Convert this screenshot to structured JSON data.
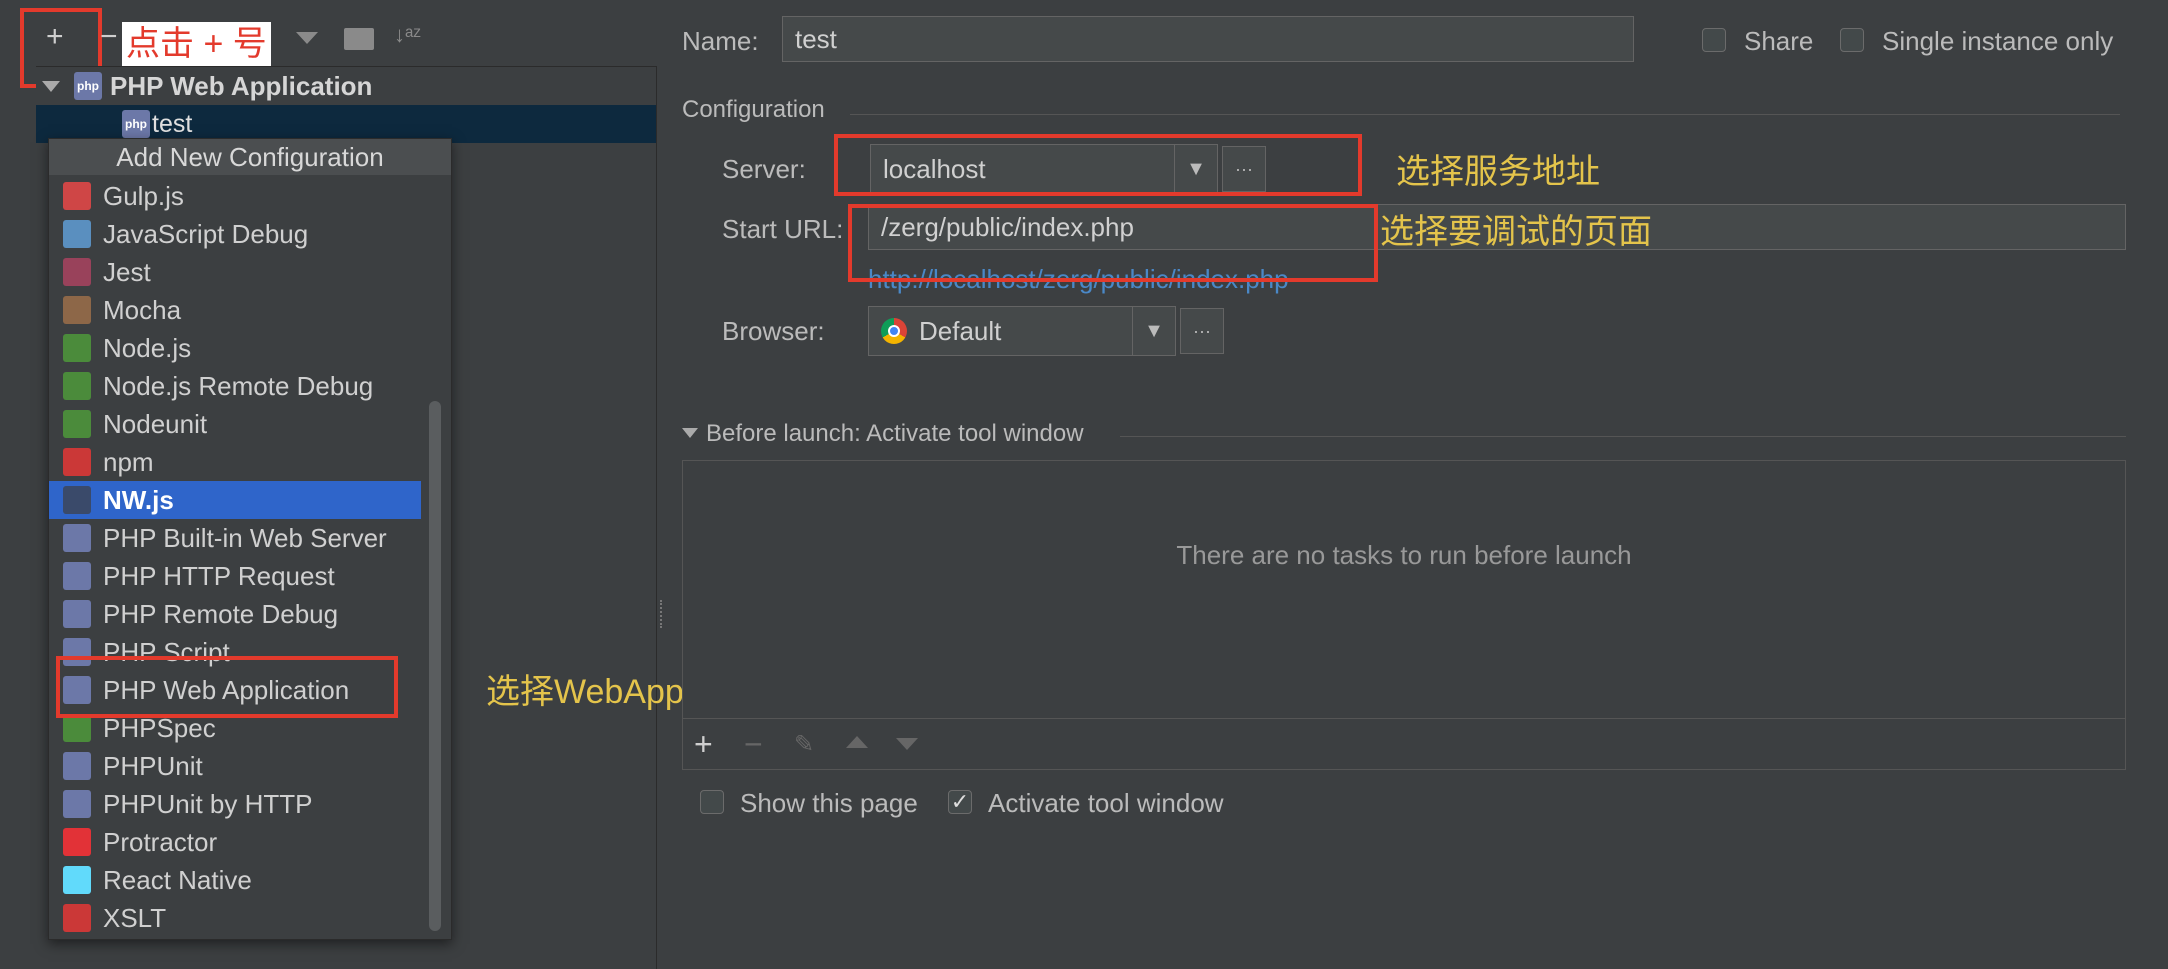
{
  "toolbar": {
    "add": "+",
    "remove": "−",
    "annotation_add": "点击 + 号"
  },
  "tree": {
    "parent": "PHP Web Application",
    "child": "test"
  },
  "popup": {
    "title": "Add New Configuration",
    "items": [
      {
        "label": "Gulp.js",
        "icon": "gulp-icon",
        "color": "#cf4646"
      },
      {
        "label": "JavaScript Debug",
        "icon": "js-debug-icon",
        "color": "#5a8fbf"
      },
      {
        "label": "Jest",
        "icon": "jest-icon",
        "color": "#99425b"
      },
      {
        "label": "Mocha",
        "icon": "mocha-icon",
        "color": "#8d6748"
      },
      {
        "label": "Node.js",
        "icon": "nodejs-icon",
        "color": "#4b8b3b"
      },
      {
        "label": "Node.js Remote Debug",
        "icon": "nodejs-remote-icon",
        "color": "#4b8b3b"
      },
      {
        "label": "Nodeunit",
        "icon": "nodeunit-icon",
        "color": "#4b8b3b"
      },
      {
        "label": "npm",
        "icon": "npm-icon",
        "color": "#cb3837"
      },
      {
        "label": "NW.js",
        "icon": "nwjs-icon",
        "color": "#3a4a6a"
      },
      {
        "label": "PHP Built-in Web Server",
        "icon": "php-server-icon",
        "color": "#6c78a8"
      },
      {
        "label": "PHP HTTP Request",
        "icon": "php-http-icon",
        "color": "#6c78a8"
      },
      {
        "label": "PHP Remote Debug",
        "icon": "php-remote-icon",
        "color": "#6c78a8"
      },
      {
        "label": "PHP Script",
        "icon": "php-script-icon",
        "color": "#6c78a8"
      },
      {
        "label": "PHP Web Application",
        "icon": "php-webapp-icon",
        "color": "#6c78a8"
      },
      {
        "label": "PHPSpec",
        "icon": "phpspec-icon",
        "color": "#4b8b3b"
      },
      {
        "label": "PHPUnit",
        "icon": "phpunit-icon",
        "color": "#6c78a8"
      },
      {
        "label": "PHPUnit by HTTP",
        "icon": "phpunit-http-icon",
        "color": "#6c78a8"
      },
      {
        "label": "Protractor",
        "icon": "protractor-icon",
        "color": "#e23237"
      },
      {
        "label": "React Native",
        "icon": "react-icon",
        "color": "#61dafb"
      },
      {
        "label": "XSLT",
        "icon": "xslt-icon",
        "color": "#cb3837"
      }
    ],
    "selected": "NW.js"
  },
  "form": {
    "name_label": "Name:",
    "name_value": "test",
    "share_label": "Share",
    "single_label": "Single instance only",
    "config_header": "Configuration",
    "server_label": "Server:",
    "server_value": "localhost",
    "url_label": "Start URL:",
    "url_value": "/zerg/public/index.php",
    "url_link": "http://localhost/zerg/public/index.php",
    "browser_label": "Browser:",
    "browser_value": "Default",
    "before_launch": "Before launch: Activate tool window",
    "no_tasks": "There are no tasks to run before launch",
    "show_page": "Show this page",
    "activate": "Activate tool window"
  },
  "annotations": {
    "server": "选择服务地址",
    "url": "选择要调试的页面",
    "webapp": "选择WebApplication 项目"
  },
  "colors": {
    "annotation_red": "#e33a2c",
    "annotation_yellow": "#e4c44b",
    "selection": "#2f65ca",
    "link": "#4a88c7"
  }
}
